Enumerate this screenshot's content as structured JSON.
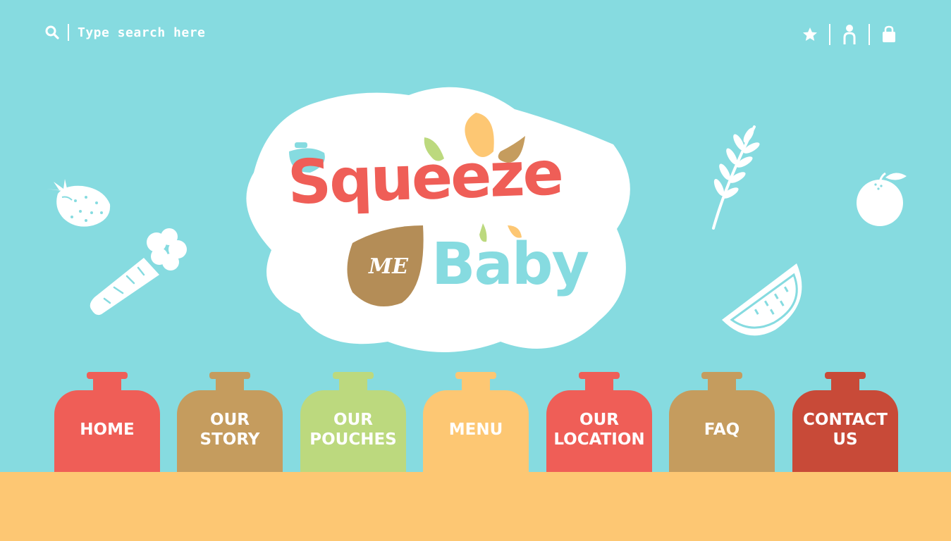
{
  "search": {
    "placeholder": "Type search here",
    "icon": "search-icon"
  },
  "header_icons": [
    "star-icon",
    "user-icon",
    "shopping-bag-icon"
  ],
  "logo": {
    "line1": "Squeeze",
    "me": "ME",
    "line2": "Baby"
  },
  "nav": [
    {
      "label": "HOME",
      "color": "#ef5e57"
    },
    {
      "label": "OUR\nSTORY",
      "color": "#c59c5e"
    },
    {
      "label": "OUR\nPOUCHES",
      "color": "#bcd97e"
    },
    {
      "label": "MENU",
      "color": "#fdc773"
    },
    {
      "label": "OUR\nLOCATION",
      "color": "#ef5e57"
    },
    {
      "label": "FAQ",
      "color": "#c59c5e"
    },
    {
      "label": "CONTACT\nUS",
      "color": "#c84a38"
    }
  ],
  "colors": {
    "background": "#86dbe0",
    "ground": "#fdc773",
    "accent_red": "#ef5e57",
    "accent_brown": "#c59c5e",
    "accent_green": "#bcd97e",
    "accent_orange": "#fdc773"
  }
}
